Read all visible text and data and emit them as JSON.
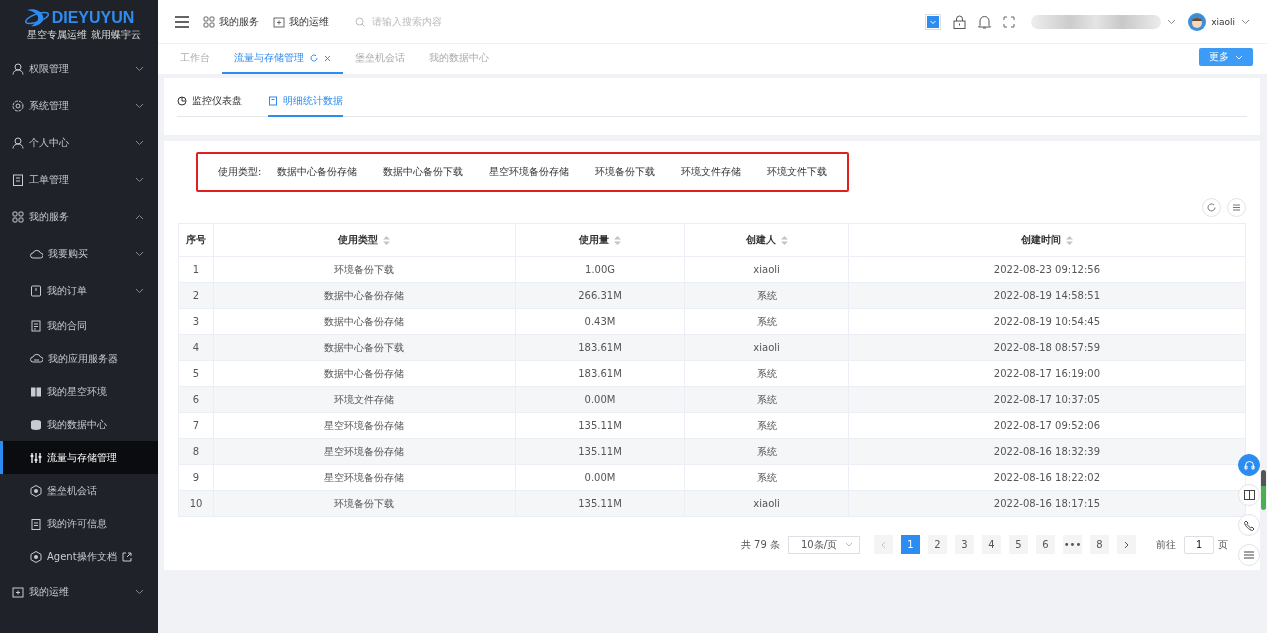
{
  "logo": {
    "name": "DIEYUYUN",
    "slogan": "星空专属运维 就用蝶宇云"
  },
  "sidebar": {
    "items": [
      {
        "label": "权限管理",
        "expanded": false,
        "selected": false
      },
      {
        "label": "系统管理",
        "expanded": false,
        "selected": false
      },
      {
        "label": "个人中心",
        "expanded": false,
        "selected": false
      },
      {
        "label": "工单管理",
        "expanded": false,
        "selected": false
      },
      {
        "label": "我的服务",
        "expanded": true,
        "selected": false,
        "children": [
          {
            "label": "我要购买",
            "expandable": true,
            "selected": false
          },
          {
            "label": "我的订单",
            "expandable": true,
            "selected": false
          },
          {
            "label": "我的合同",
            "expandable": false,
            "selected": false
          },
          {
            "label": "我的应用服务器",
            "expandable": false,
            "selected": false
          },
          {
            "label": "我的星空环境",
            "expandable": false,
            "selected": false
          },
          {
            "label": "我的数据中心",
            "expandable": false,
            "selected": false
          },
          {
            "label": "流量与存储管理",
            "expandable": false,
            "selected": true
          },
          {
            "label": "堡垒机会话",
            "expandable": false,
            "selected": false
          },
          {
            "label": "我的许可信息",
            "expandable": false,
            "selected": false
          },
          {
            "label": "Agent操作文档",
            "expandable": false,
            "selected": false,
            "external": true
          }
        ]
      },
      {
        "label": "我的运维",
        "expanded": false,
        "selected": false
      }
    ]
  },
  "header": {
    "nav": [
      "我的服务",
      "我的运维"
    ],
    "search": {
      "placeholder": "请输入搜索内容"
    },
    "user": "xiaoli"
  },
  "tabs": [
    {
      "label": "工作台",
      "selected": false
    },
    {
      "label": "流量与存储管理",
      "selected": true
    },
    {
      "label": "堡垒机会话",
      "selected": false
    },
    {
      "label": "我的数据中心",
      "selected": false
    }
  ],
  "more_button": "更多",
  "view_tabs": [
    {
      "label": "监控仪表盘",
      "selected": false
    },
    {
      "label": "明细统计数据",
      "selected": true
    }
  ],
  "filter": {
    "label": "使用类型:",
    "options": [
      "数据中心备份存储",
      "数据中心备份下载",
      "星空环境备份存储",
      "环境备份下载",
      "环境文件存储",
      "环境文件下载"
    ]
  },
  "table": {
    "columns": [
      "序号",
      "使用类型",
      "使用量",
      "创建人",
      "创建时间"
    ],
    "rows": [
      [
        "1",
        "环境备份下载",
        "1.00G",
        "xiaoli",
        "2022-08-23 09:12:56"
      ],
      [
        "2",
        "数据中心备份存储",
        "266.31M",
        "系统",
        "2022-08-19 14:58:51"
      ],
      [
        "3",
        "数据中心备份存储",
        "0.43M",
        "系统",
        "2022-08-19 10:54:45"
      ],
      [
        "4",
        "数据中心备份下载",
        "183.61M",
        "xiaoli",
        "2022-08-18 08:57:59"
      ],
      [
        "5",
        "数据中心备份存储",
        "183.61M",
        "系统",
        "2022-08-17 16:19:00"
      ],
      [
        "6",
        "环境文件存储",
        "0.00M",
        "系统",
        "2022-08-17 10:37:05"
      ],
      [
        "7",
        "星空环境备份存储",
        "135.11M",
        "系统",
        "2022-08-17 09:52:06"
      ],
      [
        "8",
        "星空环境备份存储",
        "135.11M",
        "系统",
        "2022-08-16 18:32:39"
      ],
      [
        "9",
        "星空环境备份存储",
        "0.00M",
        "系统",
        "2022-08-16 18:22:02"
      ],
      [
        "10",
        "环境备份下载",
        "135.11M",
        "xiaoli",
        "2022-08-16 18:17:15"
      ]
    ]
  },
  "pagination": {
    "total": "共 79 条",
    "page_size": "10条/页",
    "pages": [
      {
        "label": "1",
        "selected": true
      },
      {
        "label": "2",
        "selected": false
      },
      {
        "label": "3",
        "selected": false
      },
      {
        "label": "4",
        "selected": false
      },
      {
        "label": "5",
        "selected": false
      },
      {
        "label": "6",
        "selected": false
      },
      {
        "label": "•••",
        "selected": false
      },
      {
        "label": "8",
        "selected": false
      }
    ],
    "goto_label": "前往",
    "goto_value": "1",
    "goto_suffix": "页"
  }
}
